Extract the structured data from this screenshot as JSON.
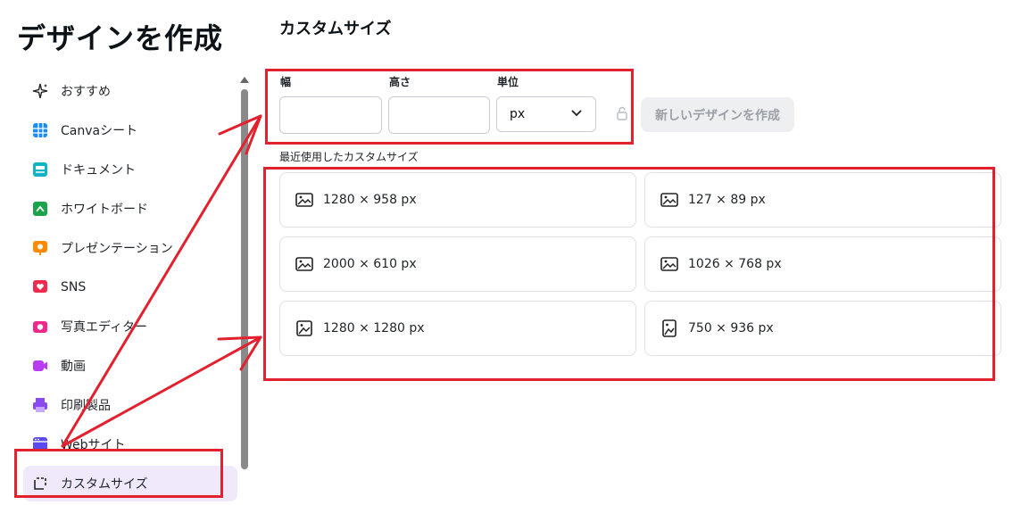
{
  "page_title": "デザインを作成",
  "sidebar": {
    "items": [
      {
        "label": "おすすめ",
        "icon": "sparkle-icon"
      },
      {
        "label": "Canvaシート",
        "icon": "sheet-icon"
      },
      {
        "label": "ドキュメント",
        "icon": "doc-icon"
      },
      {
        "label": "ホワイトボード",
        "icon": "whiteboard-icon"
      },
      {
        "label": "プレゼンテーション",
        "icon": "presentation-icon"
      },
      {
        "label": "SNS",
        "icon": "heart-icon"
      },
      {
        "label": "写真エディター",
        "icon": "camera-icon"
      },
      {
        "label": "動画",
        "icon": "video-icon"
      },
      {
        "label": "印刷製品",
        "icon": "printer-icon"
      },
      {
        "label": "Webサイト",
        "icon": "website-icon"
      },
      {
        "label": "カスタムサイズ",
        "icon": "custom-size-icon"
      }
    ],
    "active_index": 10
  },
  "main": {
    "title": "カスタムサイズ",
    "width_label": "幅",
    "height_label": "高さ",
    "unit_label": "単位",
    "width_value": "",
    "height_value": "",
    "unit_value": "px",
    "create_button": "新しいデザインを作成",
    "recent_label": "最近使用したカスタムサイズ",
    "recent_sizes": [
      {
        "label": "1280 × 958 px",
        "icon": "landscape-image-icon"
      },
      {
        "label": "127 × 89 px",
        "icon": "landscape-image-icon"
      },
      {
        "label": "2000 × 610 px",
        "icon": "landscape-image-icon"
      },
      {
        "label": "1026 × 768 px",
        "icon": "landscape-image-icon"
      },
      {
        "label": "1280 × 1280 px",
        "icon": "square-image-icon"
      },
      {
        "label": "750 × 936 px",
        "icon": "portrait-image-icon"
      }
    ]
  },
  "colors": {
    "accent_active_bg": "#efe9fb",
    "annotation_red": "#e3202e"
  }
}
